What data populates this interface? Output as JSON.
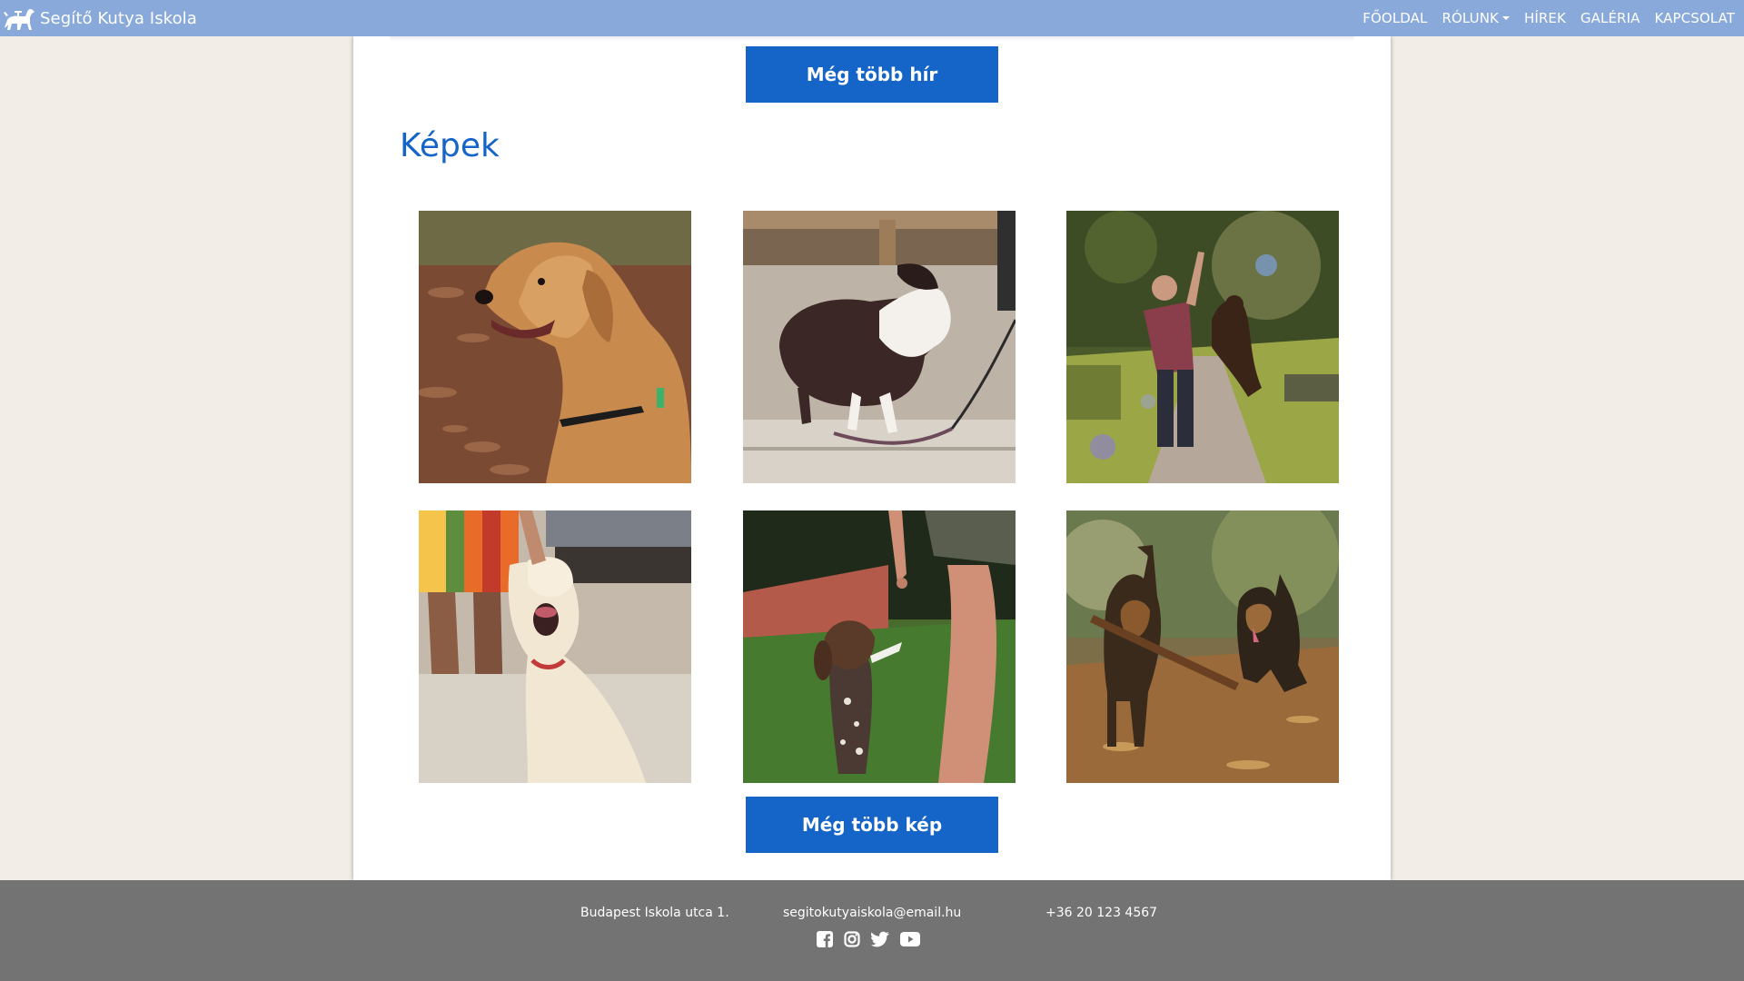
{
  "navbar": {
    "brand": "Segítő Kutya Iskola",
    "links": [
      {
        "label": "FŐOLDAL"
      },
      {
        "label": "RÓLUNK"
      },
      {
        "label": "HÍREK"
      },
      {
        "label": "GALÉRIA"
      },
      {
        "label": "KAPCSOLAT"
      }
    ]
  },
  "main": {
    "more_news_button": "Még több hír",
    "images_title": "Képek",
    "more_images_button": "Még több kép",
    "gallery": [
      {
        "icon": "golden-retriever-photo"
      },
      {
        "icon": "border-collie-photo"
      },
      {
        "icon": "dog-jumping-photo"
      },
      {
        "icon": "labrador-photo"
      },
      {
        "icon": "pointer-puppy-photo"
      },
      {
        "icon": "german-shepherds-photo"
      }
    ]
  },
  "footer": {
    "address": "Budapest Iskola utca 1.",
    "email": "segitokutyaiskola@email.hu",
    "phone": "+36 20 123 4567",
    "socials": [
      "facebook-icon",
      "instagram-icon",
      "twitter-icon",
      "youtube-icon"
    ]
  },
  "colors": {
    "navbar_bg": "#88a9d9",
    "accent": "#1565c8",
    "page_bg": "#f2ede6",
    "footer_bg": "#737373"
  }
}
